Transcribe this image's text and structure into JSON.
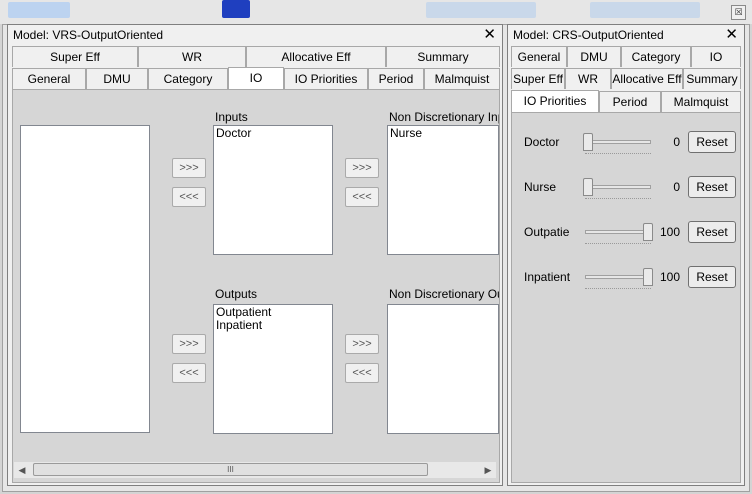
{
  "left_panel": {
    "title": "Model: VRS-OutputOriented",
    "close": "✕",
    "tabs_row1": [
      "Super Eff",
      "WR",
      "Allocative Eff",
      "Summary"
    ],
    "tabs_row2": [
      "General",
      "DMU",
      "Category",
      "IO",
      "IO Priorities",
      "Period",
      "Malmquist"
    ],
    "active_tab": "IO",
    "inputs_label": "Inputs",
    "inputs_items": [
      "Doctor"
    ],
    "nd_inputs_label": "Non Discretionary Inputs",
    "nd_inputs_items": [
      "Nurse"
    ],
    "outputs_label": "Outputs",
    "outputs_items": [
      "Outpatient",
      "Inpatient"
    ],
    "nd_outputs_label": "Non Discretionary Outputs",
    "nd_outputs_items": [],
    "move_right": ">>>",
    "move_left": "<<<",
    "scroll_left": "◀",
    "scroll_right": "▶",
    "scroll_grip": "III"
  },
  "right_panel": {
    "title": "Model: CRS-OutputOriented",
    "close": "✕",
    "tabs_row1": [
      "General",
      "DMU",
      "Category",
      "IO"
    ],
    "tabs_row2": [
      "Super Eff",
      "WR",
      "Allocative Eff",
      "Summary"
    ],
    "tabs_row3": [
      "IO Priorities",
      "Period",
      "Malmquist"
    ],
    "active_tab": "IO Priorities",
    "priorities": [
      {
        "label": "Doctor",
        "value": "0",
        "level": 0
      },
      {
        "label": "Nurse",
        "value": "0",
        "level": 0
      },
      {
        "label": "Outpatie",
        "value": "100",
        "level": 100
      },
      {
        "label": "Inpatient",
        "value": "100",
        "level": 100
      }
    ],
    "reset_label": "Reset"
  },
  "window": {
    "close_icon": "☒"
  }
}
